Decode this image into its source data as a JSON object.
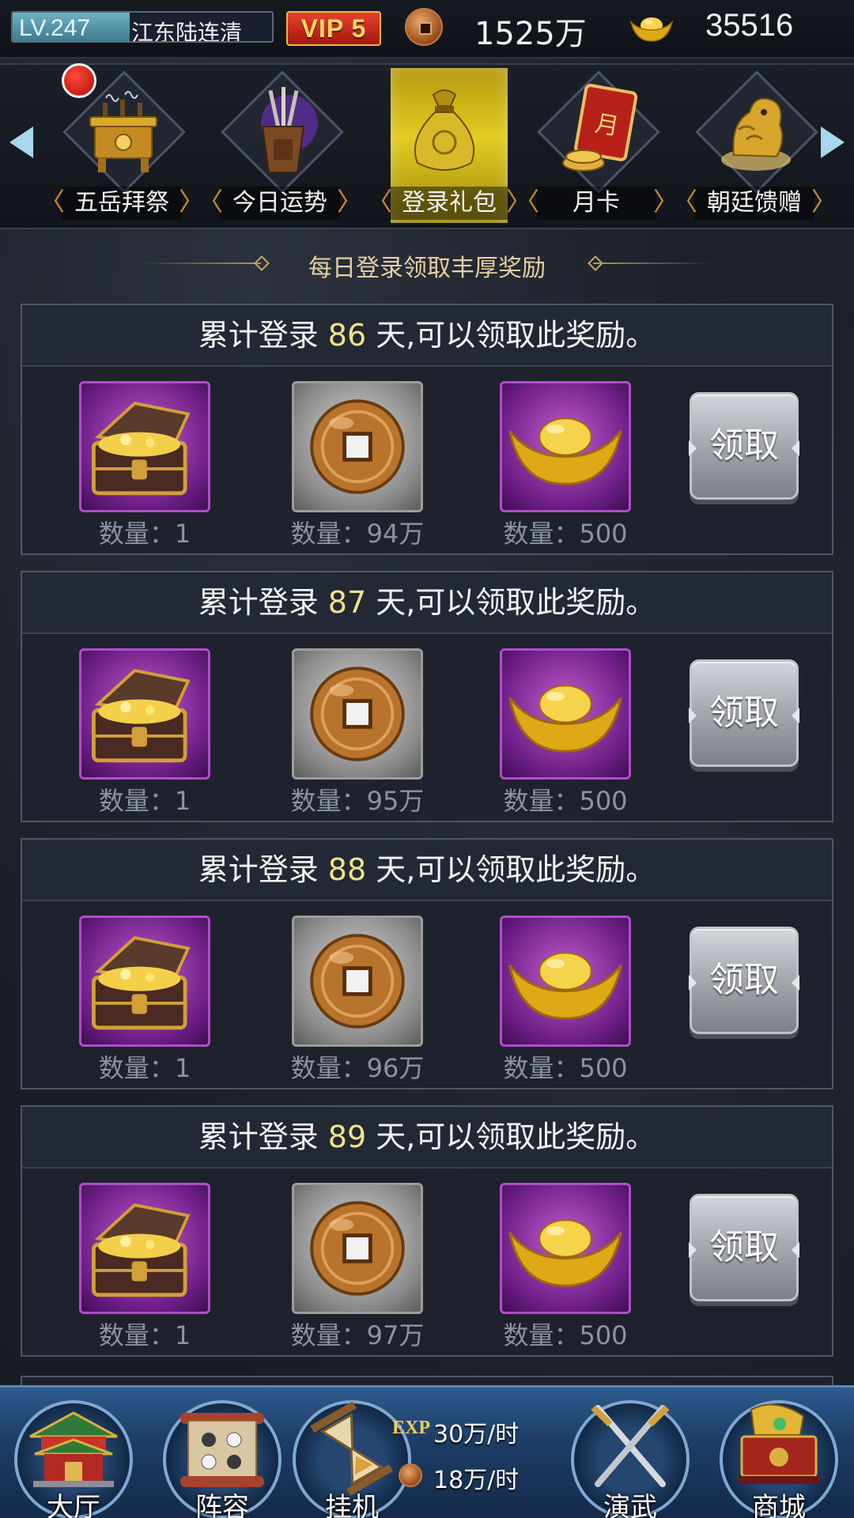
{
  "topbar": {
    "level_label": "LV.247",
    "player_name": "江东陆连清",
    "level_progress": 0.45,
    "vip_label": "VIP 5",
    "copper_amount": "1525万",
    "gold_amount": "35516"
  },
  "tabs": [
    {
      "label": "五岳拜祭",
      "icon": "incense-burner-icon",
      "has_notice": true
    },
    {
      "label": "今日运势",
      "icon": "fortune-sticks-icon",
      "has_notice": false
    },
    {
      "label": "登录礼包",
      "icon": "gift-bag-icon",
      "active": true
    },
    {
      "label": "月卡",
      "icon": "month-card-icon",
      "has_notice": false
    },
    {
      "label": "朝廷馈赠",
      "icon": "golden-beast-icon",
      "has_notice": false
    }
  ],
  "subtitle": "每日登录领取丰厚奖励",
  "rewards": [
    {
      "prefix": "累计登录 ",
      "days": "86",
      "suffix": " 天,可以领取此奖励。",
      "items": [
        {
          "icon": "treasure-chest-icon",
          "qty": "数量：1"
        },
        {
          "icon": "copper-coin-icon",
          "qty": "数量：94万"
        },
        {
          "icon": "gold-ingot-icon",
          "qty": "数量：500"
        }
      ],
      "button": "领取"
    },
    {
      "prefix": "累计登录 ",
      "days": "87",
      "suffix": " 天,可以领取此奖励。",
      "items": [
        {
          "icon": "treasure-chest-icon",
          "qty": "数量：1"
        },
        {
          "icon": "copper-coin-icon",
          "qty": "数量：95万"
        },
        {
          "icon": "gold-ingot-icon",
          "qty": "数量：500"
        }
      ],
      "button": "领取"
    },
    {
      "prefix": "累计登录 ",
      "days": "88",
      "suffix": " 天,可以领取此奖励。",
      "items": [
        {
          "icon": "treasure-chest-icon",
          "qty": "数量：1"
        },
        {
          "icon": "copper-coin-icon",
          "qty": "数量：96万"
        },
        {
          "icon": "gold-ingot-icon",
          "qty": "数量：500"
        }
      ],
      "button": "领取"
    },
    {
      "prefix": "累计登录 ",
      "days": "89",
      "suffix": " 天,可以领取此奖励。",
      "items": [
        {
          "icon": "treasure-chest-icon",
          "qty": "数量：1"
        },
        {
          "icon": "copper-coin-icon",
          "qty": "数量：97万"
        },
        {
          "icon": "gold-ingot-icon",
          "qty": "数量：500"
        }
      ],
      "button": "领取"
    }
  ],
  "bottom_nav": [
    {
      "label": "大厅",
      "icon": "palace-icon"
    },
    {
      "label": "阵容",
      "icon": "formation-scroll-icon"
    },
    {
      "label": "挂机",
      "icon": "hourglass-icon"
    },
    {
      "label": "演武",
      "icon": "crossed-swords-icon"
    },
    {
      "label": "商城",
      "icon": "treasure-shop-icon"
    }
  ],
  "idle": {
    "exp_tag": "EXP",
    "exp_rate": "30万/时",
    "coin_rate": "18万/时"
  },
  "colors": {
    "accent_gold": "#f0e38a",
    "vip_red": "#c8261a",
    "item_purple": "#b24ccc",
    "nav_blue": "#1d3d66"
  }
}
